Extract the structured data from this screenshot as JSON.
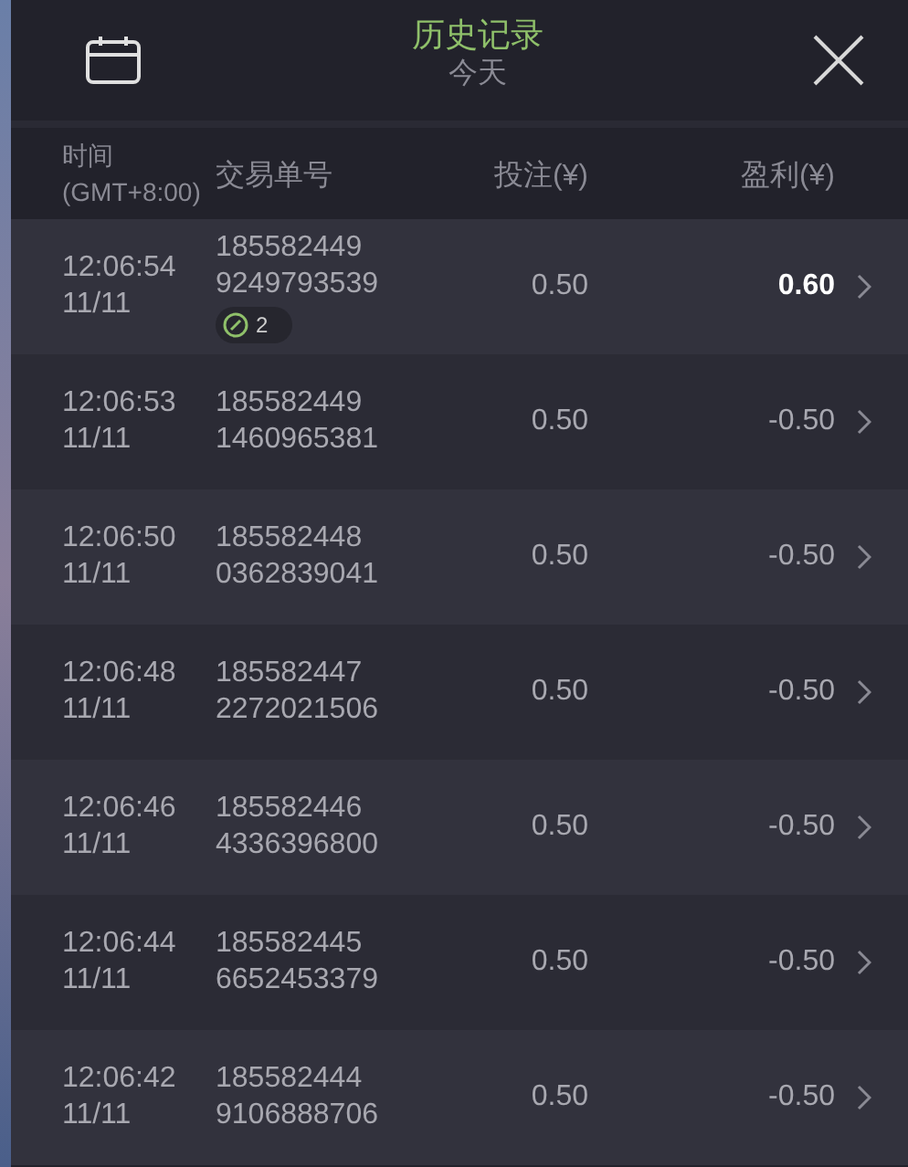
{
  "header": {
    "title": "历史记录",
    "subtitle": "今天"
  },
  "columns": [
    "时间",
    "(GMT+8:00)",
    "交易单号",
    "投注(¥)",
    "盈利(¥)"
  ],
  "rows": [
    {
      "time": "12:06:54",
      "date": "11/11",
      "id1": "185582449",
      "id2": "9249793539",
      "badge": "2",
      "stake": "0.50",
      "profit": "0.60",
      "win": true
    },
    {
      "time": "12:06:53",
      "date": "11/11",
      "id1": "185582449",
      "id2": "1460965381",
      "stake": "0.50",
      "profit": "-0.50",
      "win": false
    },
    {
      "time": "12:06:50",
      "date": "11/11",
      "id1": "185582448",
      "id2": "0362839041",
      "stake": "0.50",
      "profit": "-0.50",
      "win": false
    },
    {
      "time": "12:06:48",
      "date": "11/11",
      "id1": "185582447",
      "id2": "2272021506",
      "stake": "0.50",
      "profit": "-0.50",
      "win": false
    },
    {
      "time": "12:06:46",
      "date": "11/11",
      "id1": "185582446",
      "id2": "4336396800",
      "stake": "0.50",
      "profit": "-0.50",
      "win": false
    },
    {
      "time": "12:06:44",
      "date": "11/11",
      "id1": "185582445",
      "id2": "6652453379",
      "stake": "0.50",
      "profit": "-0.50",
      "win": false
    },
    {
      "time": "12:06:42",
      "date": "11/11",
      "id1": "185582444",
      "id2": "9106888706",
      "stake": "0.50",
      "profit": "-0.50",
      "win": false
    }
  ]
}
